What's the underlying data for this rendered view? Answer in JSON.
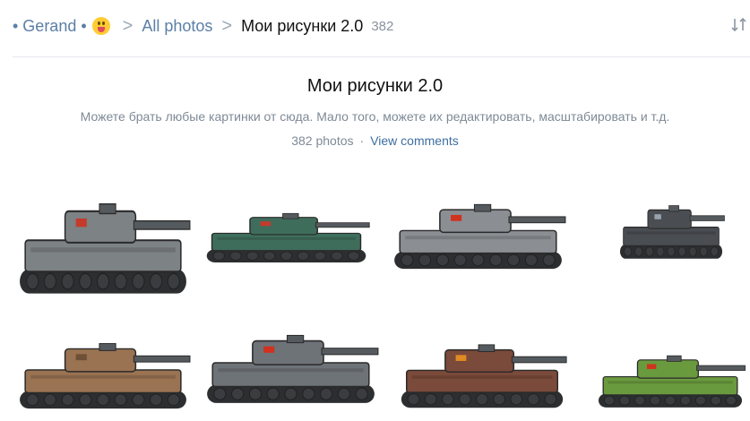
{
  "breadcrumb": {
    "owner": "• Gerand •",
    "emoji_icon": "face-with-tongue-icon",
    "separator": ">",
    "all_photos": "All photos",
    "current": "Мои рисунки 2.0",
    "count": "382"
  },
  "sort_icon": "sort-arrows-icon",
  "album": {
    "title": "Мои рисунки 2.0",
    "description": "Можете брать любые картинки от сюда. Мало того, можете их редактировать, масштабировать и т.д.",
    "photos_count": "382 photos",
    "separator": "·",
    "comments_link": "View comments"
  },
  "photos": [
    {
      "subject": "grey tank with crane arms",
      "body_color": "#7d8285",
      "accent": "#c43b2b"
    },
    {
      "subject": "green tank with long barrel",
      "body_color": "#3f6d5c",
      "accent": "#c43b2b"
    },
    {
      "subject": "large grey heavy tank",
      "body_color": "#8b8f93",
      "accent": "#d0321f"
    },
    {
      "subject": "small dark tank with horned helmet",
      "body_color": "#4a4d52",
      "accent": "#9aa3ad"
    },
    {
      "subject": "brown fortress tank",
      "body_color": "#9a7352",
      "accent": "#6d5036"
    },
    {
      "subject": "grey tank with saw barrel",
      "body_color": "#6e7378",
      "accent": "#d0321f"
    },
    {
      "subject": "rusty red monster tank",
      "body_color": "#7a4a3a",
      "accent": "#e08a22"
    },
    {
      "subject": "green tank",
      "body_color": "#6a9a3e",
      "accent": "#d0321f"
    }
  ]
}
